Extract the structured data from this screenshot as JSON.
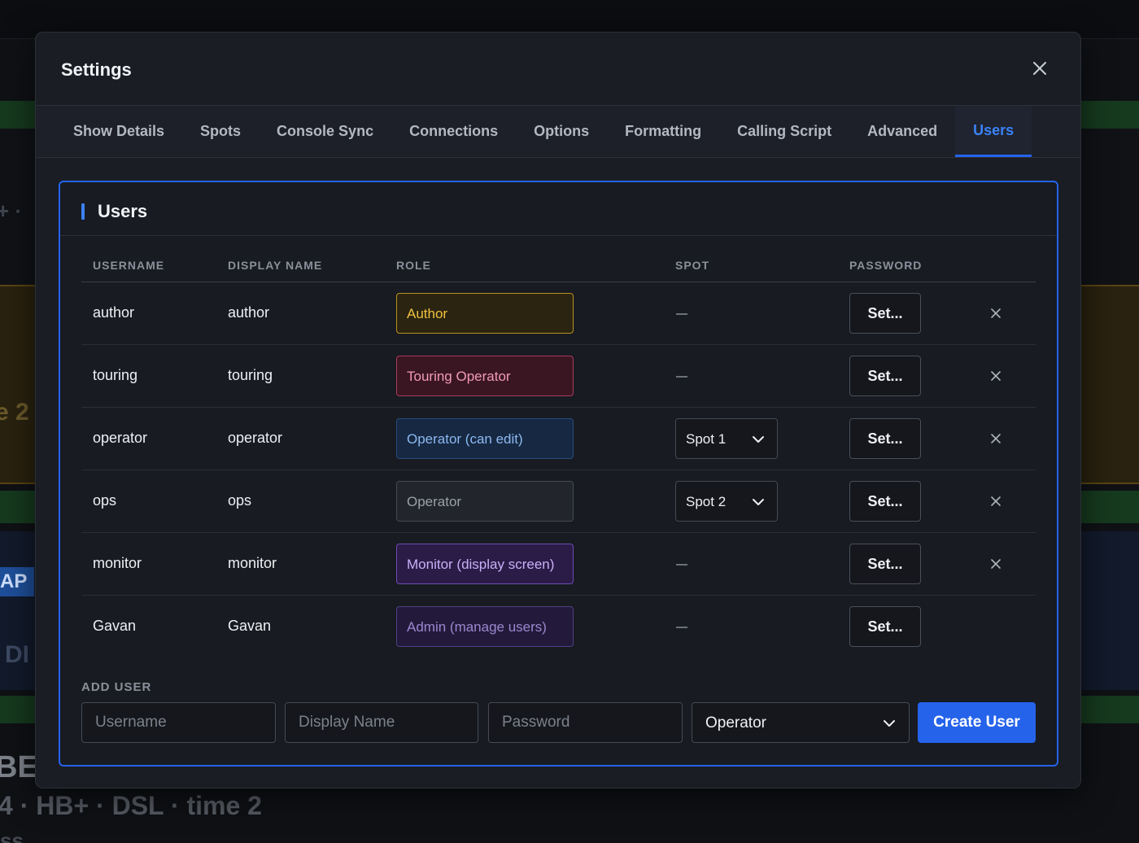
{
  "background": {
    "line1": "+ · ",
    "line2": "e 2",
    "badge": "AP",
    "line3": "DI",
    "line4": "BE",
    "line5": "4 · HB+ · DSL · time 2",
    "line6": "ss"
  },
  "modal": {
    "title": "Settings",
    "tabs": [
      {
        "label": "Show Details"
      },
      {
        "label": "Spots"
      },
      {
        "label": "Console Sync"
      },
      {
        "label": "Connections"
      },
      {
        "label": "Options"
      },
      {
        "label": "Formatting"
      },
      {
        "label": "Calling Script"
      },
      {
        "label": "Advanced"
      },
      {
        "label": "Users",
        "active": true
      }
    ]
  },
  "users_panel": {
    "title": "Users",
    "columns": {
      "username": "USERNAME",
      "display_name": "DISPLAY NAME",
      "role": "ROLE",
      "spot": "SPOT",
      "password": "PASSWORD"
    },
    "set_label": "Set...",
    "rows": [
      {
        "username": "author",
        "display_name": "author",
        "role": "Author",
        "role_style": "author",
        "spot": null,
        "deletable": true
      },
      {
        "username": "touring",
        "display_name": "touring",
        "role": "Touring Operator",
        "role_style": "touring",
        "spot": null,
        "deletable": true
      },
      {
        "username": "operator",
        "display_name": "operator",
        "role": "Operator (can edit)",
        "role_style": "opedit",
        "spot": "Spot 1",
        "deletable": true
      },
      {
        "username": "ops",
        "display_name": "ops",
        "role": "Operator",
        "role_style": "operator",
        "spot": "Spot 2",
        "deletable": true
      },
      {
        "username": "monitor",
        "display_name": "monitor",
        "role": "Monitor (display screen)",
        "role_style": "monitor",
        "spot": null,
        "deletable": true
      },
      {
        "username": "Gavan",
        "display_name": "Gavan",
        "role": "Admin (manage users)",
        "role_style": "admin",
        "spot": null,
        "deletable": false
      }
    ],
    "add_user": {
      "label": "ADD USER",
      "username_placeholder": "Username",
      "display_name_placeholder": "Display Name",
      "password_placeholder": "Password",
      "role_selected": "Operator",
      "create_label": "Create User"
    }
  },
  "colors": {
    "accent": "#2563eb",
    "modal_bg": "#1a1d24",
    "role_author": "#f0c23e",
    "role_touring": "#f29ab6",
    "role_operator_edit": "#8db8f0",
    "role_monitor": "#c9b0f7",
    "role_admin": "#9a88cf"
  },
  "icons": {
    "close": "close-icon",
    "dropdown": "chevron-down-icon",
    "delete": "x-icon"
  }
}
